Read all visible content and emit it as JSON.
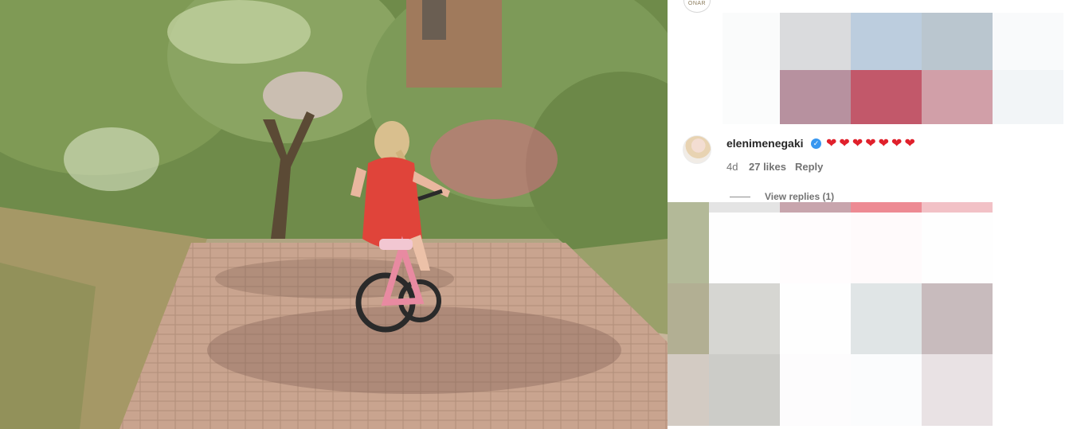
{
  "post": {
    "photo_alt": "Photo of a child in a red dress riding a pink bicycle down a shaded brick garden path"
  },
  "top_avatar": {
    "text": "ONAR"
  },
  "comment": {
    "username": "elenimenegaki",
    "verified": true,
    "text": "❤❤❤❤❤❤❤",
    "age": "4d",
    "likes": "27 likes",
    "reply_label": "Reply",
    "view_replies": "View replies (1)"
  },
  "colors": {
    "verified_blue": "#3897f0",
    "heart_red": "#e0202b",
    "username_text": "#262626",
    "meta_text": "#737373"
  }
}
